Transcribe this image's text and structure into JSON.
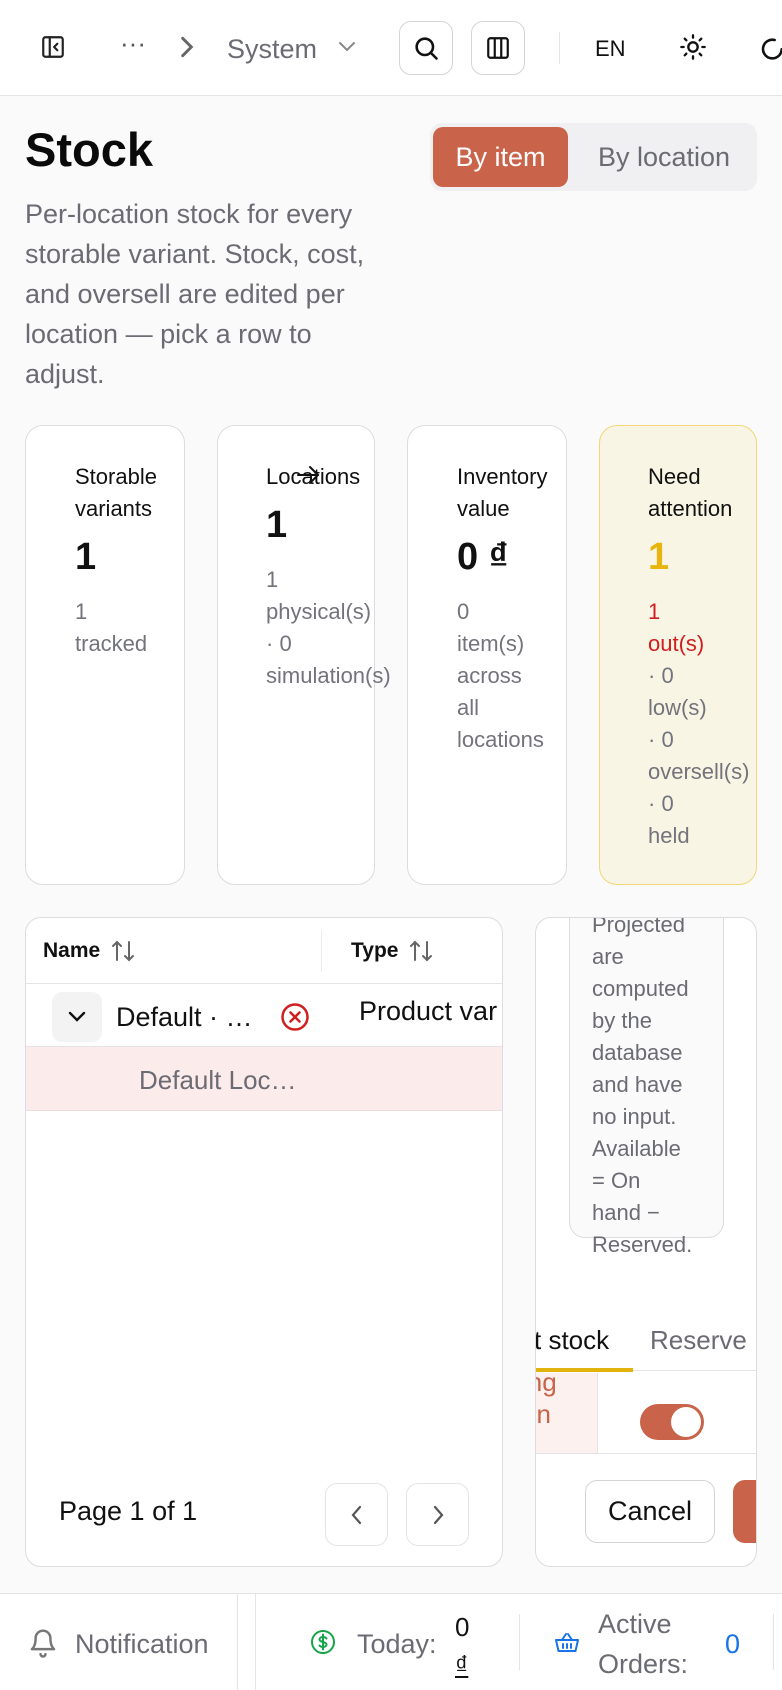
{
  "breadcrumb": {
    "ellipsis": "···",
    "current": "System"
  },
  "topbar": {
    "language": "EN"
  },
  "page": {
    "title": "Stock",
    "description": "Per-location stock for every storable variant. Stock, cost, and oversell are edited per location — pick a row to adjust.",
    "view_toggle": {
      "by_item": "By item",
      "by_location": "By location"
    }
  },
  "stats": {
    "storable": {
      "label_line1": "Storable",
      "label_line2": "variants",
      "value": "1",
      "sub_line1": "1",
      "sub_line2": "tracked"
    },
    "locations": {
      "label": "Locations",
      "value": "1",
      "sub_line1": "1",
      "sub_line2": "physical(s)",
      "sub_line3": "· 0",
      "sub_line4": "simulation(s)"
    },
    "inventory": {
      "label_line1": "Inventory",
      "label_line2": "value",
      "value": "0 ₫",
      "sub_line1": "0",
      "sub_line2": "item(s)",
      "sub_line3": "across",
      "sub_line4": "all",
      "sub_line5": "locations"
    },
    "attention": {
      "label_line1": "Need",
      "label_line2": "attention",
      "value": "1",
      "sub_line1": "1",
      "sub_line2": "out(s)",
      "sub_line3": "· 0",
      "sub_line4": "low(s)",
      "sub_line5": "· 0",
      "sub_line6": "oversell(s)",
      "sub_line7": "· 0",
      "sub_line8": "held"
    }
  },
  "table": {
    "columns": {
      "name": "Name",
      "type": "Type"
    },
    "rows": [
      {
        "name": "Default · …",
        "type": "Product var"
      },
      {
        "name": "Default Loc…"
      }
    ],
    "pager": "Page 1 of 1"
  },
  "side": {
    "note_lines": [
      "Projected",
      "are",
      "computed",
      "by the",
      "database",
      "and have",
      "no input.",
      "Available",
      "= On",
      "hand −",
      "Reserved."
    ],
    "tabs": {
      "current": "t stock",
      "reserved": "Reserve"
    },
    "cell_lines": [
      "ing",
      "en"
    ],
    "cancel": "Cancel"
  },
  "footer": {
    "notification": "Notification",
    "today_label": "Today:",
    "today_value_line1": "0",
    "today_value_line2": "₫",
    "active_orders_line1": "Active",
    "active_orders_line2": "Orders:",
    "active_orders_value": "0"
  },
  "colors": {
    "accent": "#c9634a",
    "warning": "#e8b50e",
    "danger": "#d01f1f",
    "link": "#1a73e8",
    "success": "#16a34a"
  }
}
